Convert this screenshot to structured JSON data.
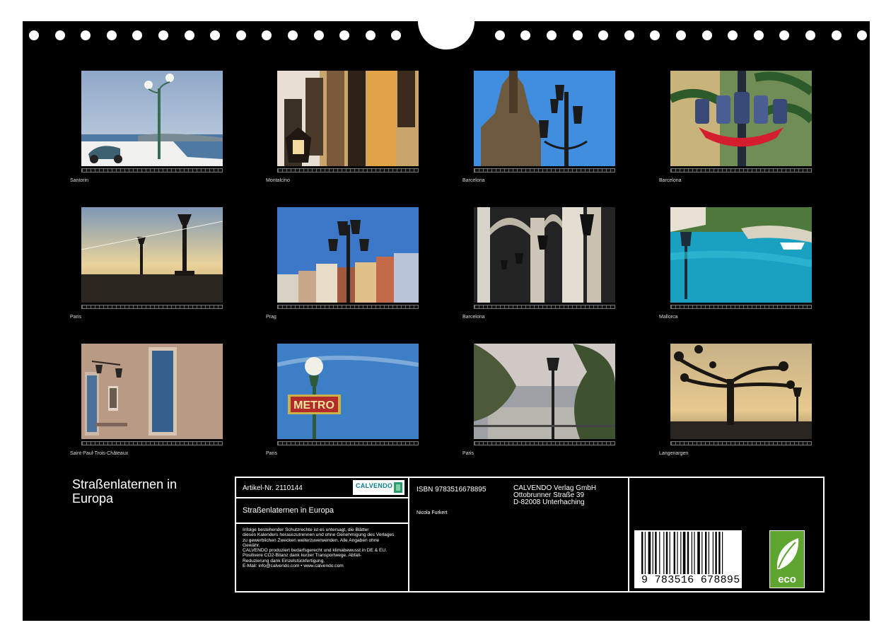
{
  "calendar": {
    "title": "Straßenlaternen in Europa",
    "photos": [
      {
        "caption": "Santorin"
      },
      {
        "caption": "Montalcino"
      },
      {
        "caption": "Barcelona"
      },
      {
        "caption": "Barcelona"
      },
      {
        "caption": "Paris"
      },
      {
        "caption": "Prag"
      },
      {
        "caption": "Barcelona"
      },
      {
        "caption": "Mallorca"
      },
      {
        "caption": "Saint-Paul-Trois-Châteaux"
      },
      {
        "caption": "Paris"
      },
      {
        "caption": "Paris"
      },
      {
        "caption": "Langenargen"
      }
    ]
  },
  "info": {
    "article_no": "Artikel-Nr. 2110144",
    "product_title": "Straßenlaternen in Europa",
    "legal_text": [
      "Infolge bestehender Schutzrechte ist es untersagt, die Blätter",
      "dieses Kalenders herauszutrennen und ohne Genehmigung des Verlages",
      "zu gewerblichen Zwecken weiterzuverwenden. Alle Angaben ohne",
      "Gewähr.",
      "CALVENDO produziert bedarfsgerecht und klimabewusst in DE & EU.",
      "Positivere CO2-Bilanz dank kurzer Transportwege. Abfall-",
      "Reduzierung dank Einzelstückfertigung.",
      "E-Mail: info@calvendo.com • www.calvendo.com"
    ],
    "isbn": "ISBN 9783516678895",
    "author": "Nicola Furkert",
    "publisher": [
      "CALVENDO Verlag GmbH",
      "Ottobrunner Straße 39",
      "D-82008 Unterhaching"
    ],
    "barcode_number": "9 783516 678895",
    "logo_text": "CALVENDO",
    "eco_label": "eco"
  }
}
